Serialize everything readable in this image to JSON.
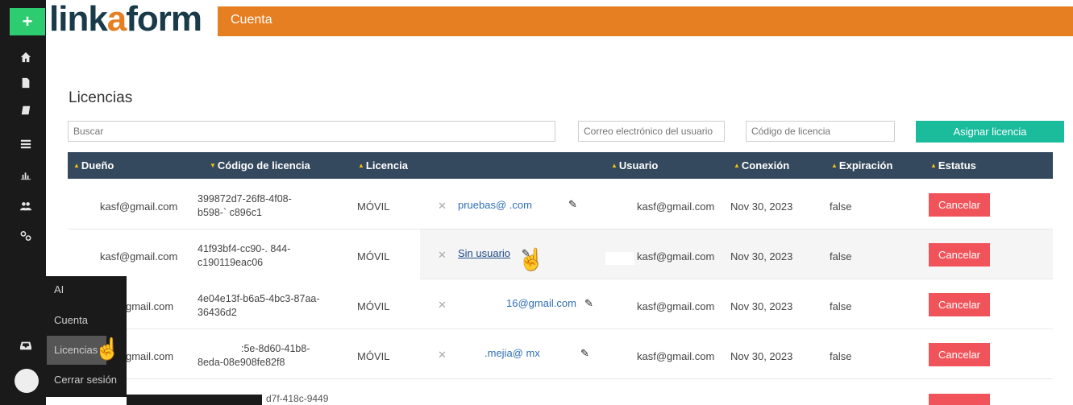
{
  "header": {
    "logo_prefix": "link",
    "logo_accent": "a",
    "logo_suffix": "form",
    "section": "Cuenta"
  },
  "rail": {
    "add_label": "+",
    "icons": [
      "home-icon",
      "document-icon",
      "book-icon",
      "list-icon",
      "chart-icon",
      "users-icon",
      "link-icon",
      "inbox-icon"
    ]
  },
  "page": {
    "title": "Licencias",
    "search_placeholder": "Buscar",
    "email_placeholder": "Correo electrónico del usuario",
    "code_placeholder": "Código de licencia",
    "assign_label": "Asignar licencia"
  },
  "table": {
    "headers": {
      "owner": "Dueño",
      "code": "Código de licencia",
      "license": "Licencia",
      "user": "Usuario",
      "connection": "Conexión",
      "expiration": "Expiración",
      "status": "Estatus"
    },
    "rows": [
      {
        "owner": "kasf@gmail.com",
        "code_line1": "399872d7-26f8-4f08-",
        "code_line2": "b598-`            c896c1",
        "license": "MÓVIL",
        "assigned": "pruebas@          .com",
        "user": "kasf@gmail.com",
        "connection": "Nov 30, 2023",
        "expiration": "false",
        "action": "Cancelar"
      },
      {
        "owner": "kasf@gmail.com",
        "code_line1": "41f93bf4-cc90-.           844-",
        "code_line2": "c190119eac06",
        "license": "MÓVIL",
        "assigned": "Sin usuario",
        "user": "kasf@gmail.com",
        "connection": "Nov 30, 2023",
        "expiration": "false",
        "action": "Cancelar"
      },
      {
        "owner": "gmail.com",
        "code_line1": "4e04e13f-b6a5-4bc3-87aa-",
        "code_line2": "36436d2",
        "license": "MÓVIL",
        "assigned": "16@gmail.com",
        "user": "kasf@gmail.com",
        "connection": "Nov 30, 2023",
        "expiration": "false",
        "action": "Cancelar"
      },
      {
        "owner": "gmail.com",
        "code_line1": ":5e-8d60-41b8-",
        "code_line2": "8eda-08e908fe82f8",
        "license": "MÓVIL",
        "assigned": ".mejia@            mx",
        "user": "kasf@gmail.com",
        "connection": "Nov 30, 2023",
        "expiration": "false",
        "action": "Cancelar"
      }
    ],
    "partial_code": "d7f-418c-9449"
  },
  "menu": {
    "items": [
      "AI",
      "Cuenta",
      "Licencias",
      "Cerrar sesión"
    ]
  },
  "colors": {
    "brand_orange": "#e67e22",
    "header_dark": "#34495e",
    "accent_green": "#1abc9c",
    "cancel_red": "#f0545a"
  }
}
